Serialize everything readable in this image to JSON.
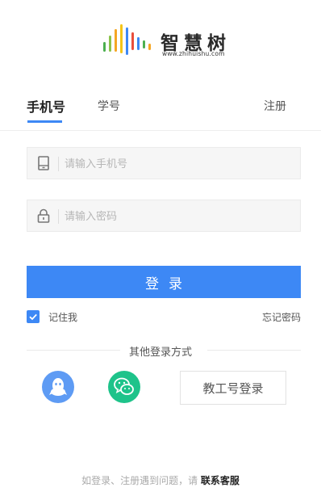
{
  "logo": {
    "name": "智慧树",
    "url": "www.zhihuishu.com",
    "bar_colors": [
      "#4caf50",
      "#f5a623",
      "#3d88f5",
      "#e94e3c",
      "#8bc34a",
      "#f5c518",
      "#3d88f5"
    ]
  },
  "tabs": {
    "phone": "手机号",
    "student_id": "学号",
    "register": "注册"
  },
  "form": {
    "phone_placeholder": "请输入手机号",
    "password_placeholder": "请输入密码",
    "login_label": "登录",
    "remember_label": "记住我",
    "remember_checked": true,
    "forgot_label": "忘记密码"
  },
  "other_login": {
    "divider_text": "其他登录方式",
    "qq_icon": "qq-icon",
    "wechat_icon": "wechat-icon",
    "staff_label": "教工号登录"
  },
  "footer": {
    "text": "如登录、注册遇到问题，请",
    "contact": "联系客服"
  },
  "colors": {
    "accent": "#3d88f5",
    "qq": "#5e9bf4",
    "wechat": "#1ec38a"
  }
}
